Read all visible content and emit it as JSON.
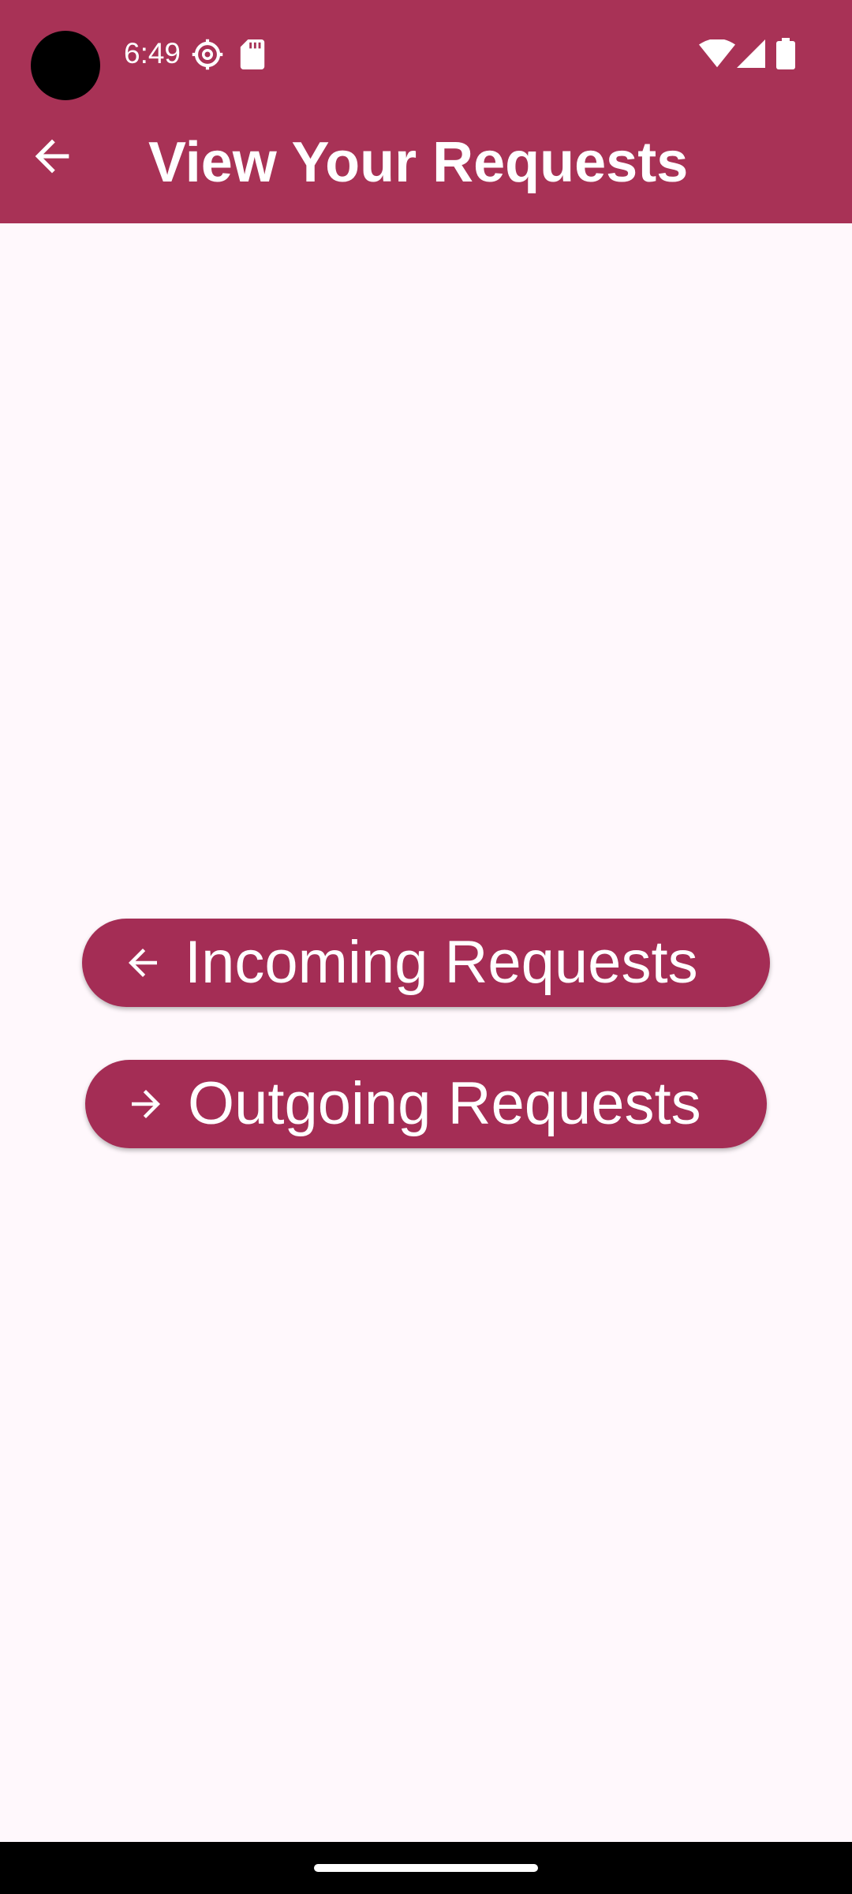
{
  "status_bar": {
    "time": "6:49",
    "icons": [
      "settings-icon",
      "sd-card-icon",
      "wifi-icon",
      "signal-icon",
      "battery-icon"
    ]
  },
  "app_bar": {
    "title": "View Your Requests",
    "back_icon": "arrow-back-icon"
  },
  "main": {
    "buttons": [
      {
        "label": "Incoming Requests",
        "icon": "arrow-left-icon"
      },
      {
        "label": "Outgoing Requests",
        "icon": "arrow-right-icon"
      }
    ]
  },
  "colors": {
    "primary": "#A83256",
    "button": "#A42D55",
    "background": "#FFF8FC",
    "on_primary": "#FFFFFF"
  }
}
